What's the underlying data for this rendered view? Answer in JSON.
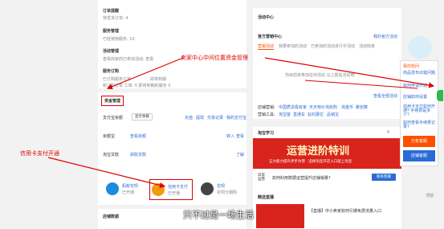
{
  "left": {
    "order_manage": "订单提醒",
    "order_pending": "待发货订单: 4",
    "service_manage": "服务管理",
    "service_used": "已经使用服务: 10",
    "activity_manage": "活动管理",
    "activity_desc": "查看商家的已参加活动: 查看",
    "service_order": "服务订购",
    "service_order_note": "已订购服务订单",
    "service_order_right": "即将到期",
    "service_sub_note": "新订购订单 工单: 0   即将到期的服务 0"
  },
  "fund": {
    "title": "资金管理",
    "pay_account_label": "支付宝余额",
    "pay_account_btn": "显示余额",
    "links": [
      "充值",
      "提现",
      "交易记录",
      "我的支付宝"
    ],
    "balance_label": "余额宝",
    "balance_value": "查看余额",
    "balance_links": [
      "转入",
      "查看"
    ],
    "loan_label": "淘宝贷款",
    "loan_value": "获取贷款",
    "loan_link": "了解",
    "pay_items": [
      {
        "icon": "alipay-icon",
        "title": "蚂蚁花呗",
        "sub": "已开通"
      },
      {
        "icon": "credit-card-icon",
        "title": "信用卡支付",
        "sub": "已开通"
      },
      {
        "icon": "installment-icon",
        "title": "花呗",
        "sub": "花呗分期购"
      }
    ]
  },
  "shop_data": {
    "title": "店铺数据"
  },
  "annotations": {
    "fund_center": "卖家中心中间位置资金管理",
    "credit_card": "信用卡支付开通",
    "subtitle": "只不过是一场生活"
  },
  "activity": {
    "title": "活动中心",
    "section": "官方营销中心",
    "more": "我的官方活动",
    "tabs": [
      "营销活动",
      "我要参加的活动",
      "已参加的活动",
      "进行中活动",
      "活动结束"
    ],
    "empty": "你目前未参加任何活动 马上报名活动吧",
    "view_all": "查看全部活动",
    "links_label": "店铺营销:",
    "links": [
      "中国质造",
      "极有家",
      "天天特价",
      "淘抢购",
      "淘金币",
      "聚划算"
    ],
    "links2_label": "营销工具:",
    "links2": [
      "淘宝客",
      "直通车",
      "钻石展位",
      "品销宝"
    ]
  },
  "ad": {
    "title": "淘宝学习",
    "banner_main": "运营进阶特训",
    "banner_sub": "五大能力提升步步为营 · 选择淘宝开店入口就上淘宝",
    "line1_left": "日常\n运营",
    "line1_text": "如何利用数据运营提升店铺销量?",
    "line1_btn": "联系客服",
    "live_title": "精选直播",
    "live_caption": "【直播】中小卖家如何引爆免费流量入口"
  },
  "float_panel": {
    "title": "猜你想问",
    "items": [
      "商品发布出错问题",
      "如何申请开通",
      "店铺如何设置",
      "信用卡支付如何开通? 手续费是多少?",
      "如何查看手续费记录?"
    ],
    "btn1": "万象客服",
    "btn2": "店铺客服"
  },
  "side": {
    "top_label": "顶部"
  },
  "colors": {
    "accent_red": "#e00000",
    "blue_link": "#2b6cd4",
    "orange": "#ff5000"
  }
}
